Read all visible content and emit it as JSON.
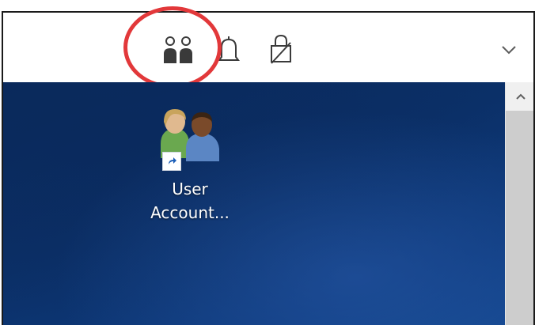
{
  "toolbar": {
    "icons": [
      "people-icon",
      "bell-icon",
      "lock-icon",
      "chevron-down-icon"
    ]
  },
  "desktop": {
    "shortcut": {
      "icon": "user-accounts-icon",
      "label_line1": "User",
      "label_line2": "Account..."
    }
  },
  "colors": {
    "highlight": "#e2383a",
    "desktop_bg": "#0b3068"
  }
}
